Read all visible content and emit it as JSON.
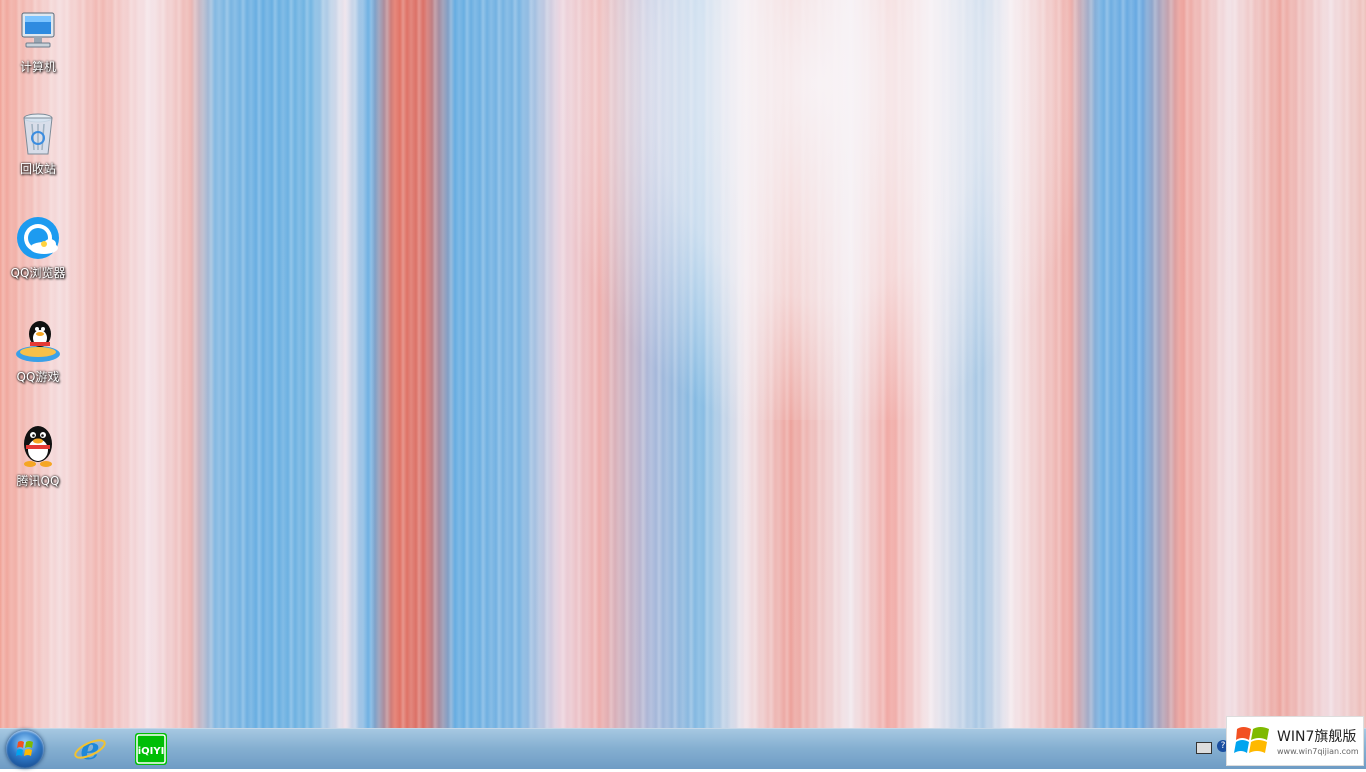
{
  "desktop": {
    "icons": [
      {
        "label": "计算机",
        "icon": "computer-icon"
      },
      {
        "label": "回收站",
        "icon": "recycle-bin-icon"
      },
      {
        "label": "QQ浏览器",
        "icon": "qq-browser-icon"
      },
      {
        "label": "QQ游戏",
        "icon": "qq-game-icon"
      },
      {
        "label": "腾讯QQ",
        "icon": "qq-penguin-icon"
      }
    ]
  },
  "taskbar": {
    "pinned": [
      {
        "icon": "start-orb-icon"
      },
      {
        "icon": "internet-explorer-icon"
      },
      {
        "icon": "iqiyi-icon",
        "text": "iQIYI"
      }
    ],
    "tray": {
      "help_glyph": "?"
    }
  },
  "watermark": {
    "title": "WIN7旗舰版",
    "url": "www.win7qijian.com"
  },
  "colors": {
    "taskbar": "#6e9fc8",
    "iqiyi_green": "#00be06",
    "ie_blue": "#1e88d8"
  }
}
